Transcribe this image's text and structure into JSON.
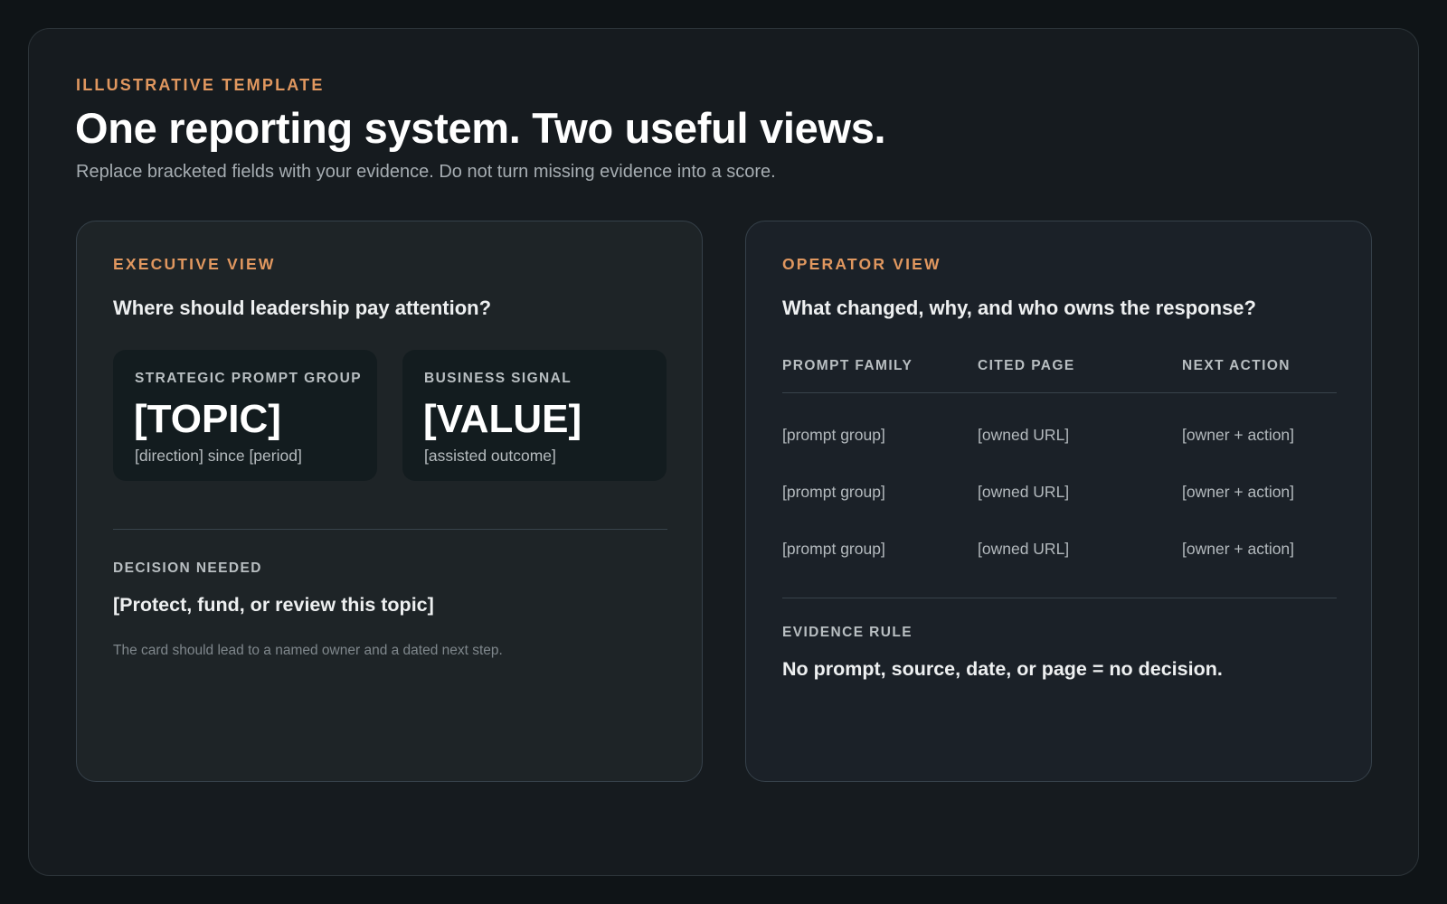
{
  "header": {
    "eyebrow": "ILLUSTRATIVE TEMPLATE",
    "title": "One reporting system. Two useful views.",
    "subtitle": "Replace bracketed fields with your evidence. Do not turn missing evidence into a score."
  },
  "executive": {
    "label": "EXECUTIVE VIEW",
    "question": "Where should leadership pay attention?",
    "metrics": [
      {
        "label": "STRATEGIC PROMPT GROUP",
        "value": "[TOPIC]",
        "note": "[direction] since [period]"
      },
      {
        "label": "BUSINESS SIGNAL",
        "value": "[VALUE]",
        "note": "[assisted outcome]"
      }
    ],
    "decision_label": "DECISION NEEDED",
    "decision_text": "[Protect, fund, or review this topic]",
    "decision_note": "The card should lead to a named owner and a dated next step."
  },
  "operator": {
    "label": "OPERATOR VIEW",
    "question": "What changed, why, and who owns the response?",
    "columns": [
      "PROMPT FAMILY",
      "CITED PAGE",
      "NEXT ACTION"
    ],
    "rows": [
      [
        "[prompt group]",
        "[owned URL]",
        "[owner + action]"
      ],
      [
        "[prompt group]",
        "[owned URL]",
        "[owner + action]"
      ],
      [
        "[prompt group]",
        "[owned URL]",
        "[owner + action]"
      ]
    ],
    "rule_label": "EVIDENCE RULE",
    "rule_text": "No prompt, source, date, or page = no decision."
  }
}
